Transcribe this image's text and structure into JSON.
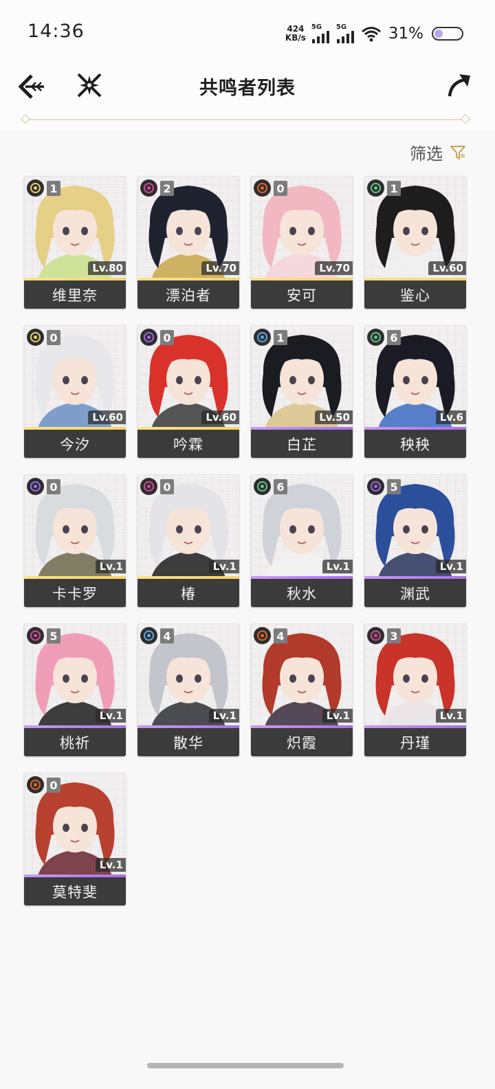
{
  "status_bar": {
    "time": "14:36",
    "net_speed_value": "424",
    "net_speed_unit": "KB/s",
    "signal_1_label": "5G",
    "signal_2_label": "5G",
    "battery_percent": "31%",
    "battery_level": 0.31
  },
  "header": {
    "title": "共鸣者列表",
    "back_icon": "back-arrow-icon",
    "logo_icon": "game-logo-icon",
    "share_icon": "share-icon"
  },
  "filter": {
    "label": "筛选",
    "icon": "filter-icon",
    "accent_color": "#c8a24a"
  },
  "characters": [
    {
      "name": "维里奈",
      "level": "Lv.80",
      "sequence": "1",
      "element": "spectro",
      "rarity": "gold",
      "hair": "#e6cf86",
      "accent": "#c8e08a"
    },
    {
      "name": "漂泊者",
      "level": "Lv.70",
      "sequence": "2",
      "element": "havoc",
      "rarity": "gold",
      "hair": "#1f2330",
      "accent": "#c9a64a"
    },
    {
      "name": "安可",
      "level": "Lv.70",
      "sequence": "0",
      "element": "fusion",
      "rarity": "gold",
      "hair": "#f2b8c2",
      "accent": "#f6d2da"
    },
    {
      "name": "鉴心",
      "level": "Lv.60",
      "sequence": "1",
      "element": "aero",
      "rarity": "gold",
      "hair": "#1d1d1d",
      "accent": "#f0f0f0"
    },
    {
      "name": "今汐",
      "level": "Lv.60",
      "sequence": "0",
      "element": "spectro",
      "rarity": "gold",
      "hair": "#e8e8ea",
      "accent": "#6b8fc6"
    },
    {
      "name": "吟霖",
      "level": "Lv.60",
      "sequence": "0",
      "element": "electro",
      "rarity": "gold",
      "hair": "#d8322b",
      "accent": "#3a3a3a"
    },
    {
      "name": "白芷",
      "level": "Lv.50",
      "sequence": "1",
      "element": "glacio",
      "rarity": "purple",
      "hair": "#1b1b22",
      "accent": "#d9c389"
    },
    {
      "name": "秧秧",
      "level": "Lv.6",
      "sequence": "6",
      "element": "aero",
      "rarity": "purple",
      "hair": "#1a1b24",
      "accent": "#3c6bc4"
    },
    {
      "name": "卡卡罗",
      "level": "Lv.1",
      "sequence": "0",
      "element": "electro",
      "rarity": "gold",
      "hair": "#d9dcdf",
      "accent": "#6f6a4e"
    },
    {
      "name": "椿",
      "level": "Lv.1",
      "sequence": "0",
      "element": "havoc",
      "rarity": "gold",
      "hair": "#e3e3e8",
      "accent": "#1d1d1d"
    },
    {
      "name": "秋水",
      "level": "Lv.1",
      "sequence": "6",
      "element": "aero",
      "rarity": "purple",
      "hair": "#cfd2d8",
      "accent": "#f2f2f2"
    },
    {
      "name": "渊武",
      "level": "Lv.1",
      "sequence": "5",
      "element": "electro",
      "rarity": "purple",
      "hair": "#2c4f9b",
      "accent": "#27345c"
    },
    {
      "name": "桃祈",
      "level": "Lv.1",
      "sequence": "5",
      "element": "havoc",
      "rarity": "purple",
      "hair": "#f09db8",
      "accent": "#1d1d1d"
    },
    {
      "name": "散华",
      "level": "Lv.1",
      "sequence": "4",
      "element": "glacio",
      "rarity": "purple",
      "hair": "#c3c5cc",
      "accent": "#2e3036"
    },
    {
      "name": "炽霞",
      "level": "Lv.1",
      "sequence": "4",
      "element": "fusion",
      "rarity": "purple",
      "hair": "#b13a2a",
      "accent": "#3a2b3c"
    },
    {
      "name": "丹瑾",
      "level": "Lv.1",
      "sequence": "3",
      "element": "havoc",
      "rarity": "purple",
      "hair": "#c9332a",
      "accent": "#ebe4e8"
    },
    {
      "name": "莫特斐",
      "level": "Lv.1",
      "sequence": "0",
      "element": "fusion",
      "rarity": "purple",
      "hair": "#b8402f",
      "accent": "#6b2430"
    }
  ],
  "element_colors": {
    "spectro": "#e9d26a",
    "havoc": "#d04a9a",
    "fusion": "#e2662e",
    "aero": "#5fc78a",
    "electro": "#9a6be2",
    "glacio": "#5fa8e6"
  }
}
